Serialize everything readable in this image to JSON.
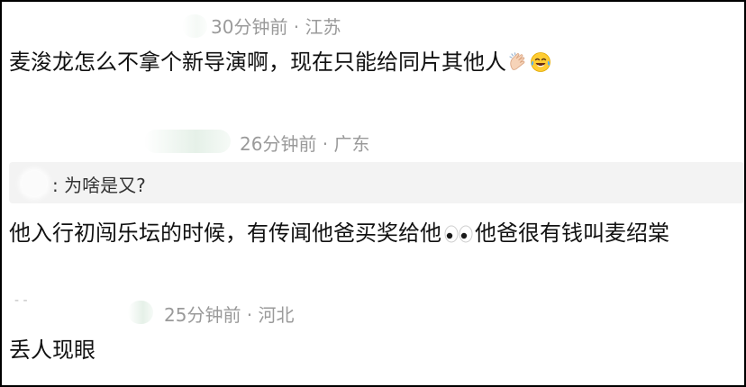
{
  "comments": [
    {
      "meta": "30分钟前 · 江苏",
      "text": "麦浚龙怎么不拿个新导演啊，现在只能给同片其他人",
      "emojis": [
        "clapping-hands-icon",
        "tears-of-joy-icon"
      ]
    },
    {
      "meta": "26分钟前 · 广东",
      "quote": "为啥是又?",
      "text_before_eyes": "他入行初闯乐坛的时候，有传闻他爸买奖给他",
      "text_after_eyes": "他爸很有钱叫麦绍棠",
      "emojis": [
        "eyes-icon"
      ]
    },
    {
      "meta": "25分钟前 · 河北",
      "text": "丢人现眼"
    }
  ]
}
